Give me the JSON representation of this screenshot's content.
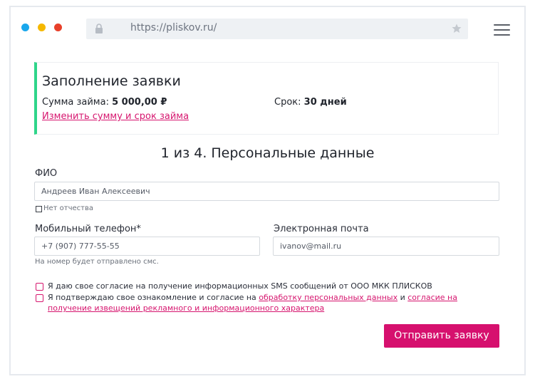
{
  "browser": {
    "url": "https://pliskov.ru/"
  },
  "summary": {
    "title": "Заполнение заявки",
    "amount_label": "Сумма займа: ",
    "amount_value": "5 000,00 ₽",
    "term_label": "Срок: ",
    "term_value": "30 дней",
    "change_link": "Изменить сумму и срок займа"
  },
  "step": {
    "title": "1 из 4. Персональные данные"
  },
  "form": {
    "fio_label": "ФИО",
    "fio_value": "Андреев Иван Алексеевич",
    "no_patronymic": "Нет отчества",
    "phone_label": "Мобильный телефон*",
    "phone_value": "+7 (907) 777-55-55",
    "phone_hint": "На номер будет отправлено смс.",
    "email_label": "Электронная почта",
    "email_value": "ivanov@mail.ru"
  },
  "consents": {
    "sms": "Я даю свое согласие на получение информационных SMS сообщений от ООО МКК ПЛИСКОВ",
    "pd_prefix": "Я подтверждаю свое ознакомление и согласие на ",
    "pd_link": "обработку персональных данных",
    "pd_and": " и ",
    "ads_link_1": "согласие на",
    "ads_link_2": "получение извещений рекламного и информационного характера"
  },
  "submit_label": "Отправить заявку",
  "colors": {
    "accent": "#d6106e",
    "success_border": "#2fd58a"
  }
}
